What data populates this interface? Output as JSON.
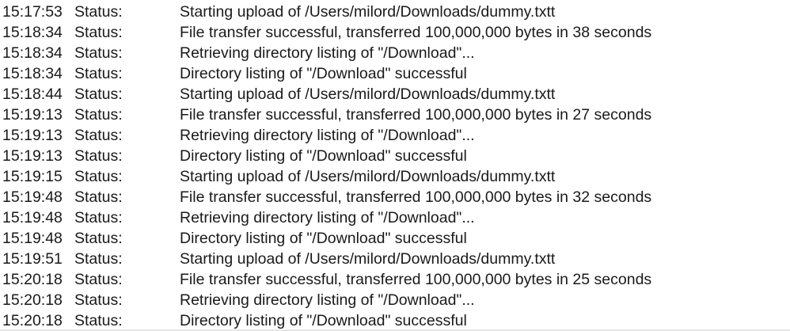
{
  "log": {
    "rows": [
      {
        "time": "15:17:53",
        "type": "Status:",
        "message": "Starting upload of /Users/milord/Downloads/dummy.txtt"
      },
      {
        "time": "15:18:34",
        "type": "Status:",
        "message": "File transfer successful, transferred 100,000,000 bytes in 38 seconds"
      },
      {
        "time": "15:18:34",
        "type": "Status:",
        "message": "Retrieving directory listing of \"/Download\"..."
      },
      {
        "time": "15:18:34",
        "type": "Status:",
        "message": "Directory listing of \"/Download\" successful"
      },
      {
        "time": "15:18:44",
        "type": "Status:",
        "message": "Starting upload of /Users/milord/Downloads/dummy.txtt"
      },
      {
        "time": "15:19:13",
        "type": "Status:",
        "message": "File transfer successful, transferred 100,000,000 bytes in 27 seconds"
      },
      {
        "time": "15:19:13",
        "type": "Status:",
        "message": "Retrieving directory listing of \"/Download\"..."
      },
      {
        "time": "15:19:13",
        "type": "Status:",
        "message": "Directory listing of \"/Download\" successful"
      },
      {
        "time": "15:19:15",
        "type": "Status:",
        "message": "Starting upload of /Users/milord/Downloads/dummy.txtt"
      },
      {
        "time": "15:19:48",
        "type": "Status:",
        "message": "File transfer successful, transferred 100,000,000 bytes in 32 seconds"
      },
      {
        "time": "15:19:48",
        "type": "Status:",
        "message": "Retrieving directory listing of \"/Download\"..."
      },
      {
        "time": "15:19:48",
        "type": "Status:",
        "message": "Directory listing of \"/Download\" successful"
      },
      {
        "time": "15:19:51",
        "type": "Status:",
        "message": "Starting upload of /Users/milord/Downloads/dummy.txtt"
      },
      {
        "time": "15:20:18",
        "type": "Status:",
        "message": "File transfer successful, transferred 100,000,000 bytes in 25 seconds"
      },
      {
        "time": "15:20:18",
        "type": "Status:",
        "message": "Retrieving directory listing of \"/Download\"..."
      },
      {
        "time": "15:20:18",
        "type": "Status:",
        "message": "Directory listing of \"/Download\" successful"
      }
    ]
  }
}
